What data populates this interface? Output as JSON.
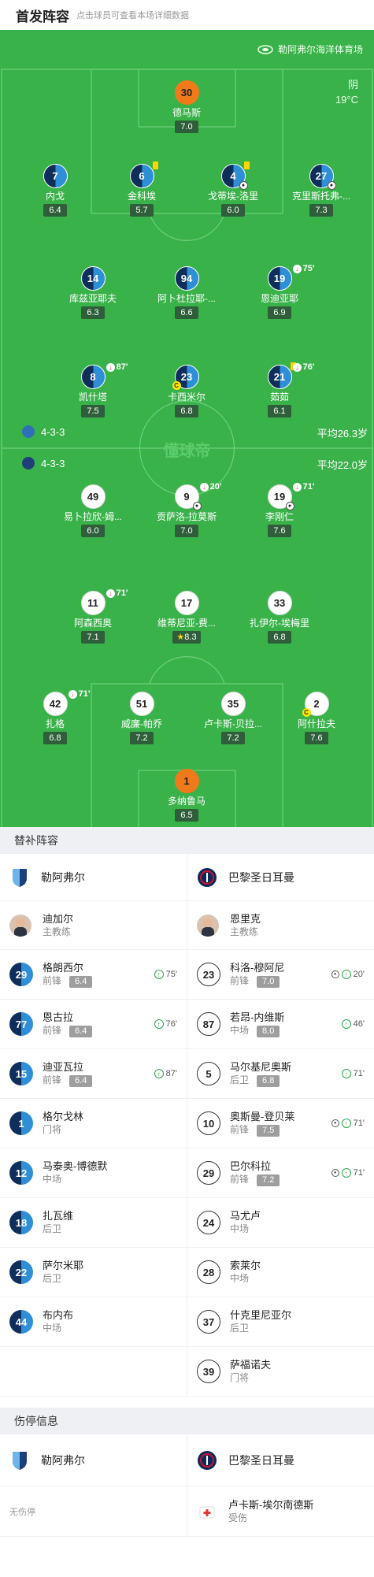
{
  "header": {
    "title": "首发阵容",
    "hint": "点击球员可查看本场详细数据"
  },
  "venue": "勒阿弗尔海洋体育场",
  "weather": {
    "condition": "阴",
    "temp": "19°C"
  },
  "home": {
    "formation": "4-3-3",
    "avg_age": "平均26.3岁",
    "players": [
      {
        "num": "30",
        "name": "德马斯",
        "rating": "7.0",
        "gk": true
      },
      {
        "num": "7",
        "name": "内戈",
        "rating": "6.4"
      },
      {
        "num": "6",
        "name": "金科埃",
        "rating": "5.7",
        "yellow": true
      },
      {
        "num": "4",
        "name": "戈蒂埃-洛里",
        "rating": "6.0",
        "yellow": true,
        "goal": true
      },
      {
        "num": "27",
        "name": "克里斯托弗-...",
        "rating": "7.3",
        "goal": true
      },
      {
        "num": "14",
        "name": "库兹亚耶夫",
        "rating": "6.3"
      },
      {
        "num": "94",
        "name": "阿卜杜拉耶-...",
        "rating": "6.6"
      },
      {
        "num": "19",
        "name": "恩迪亚耶",
        "rating": "6.9",
        "sub": "75'"
      },
      {
        "num": "8",
        "name": "凯什塔",
        "rating": "7.5",
        "sub": "87'"
      },
      {
        "num": "23",
        "name": "卡西米尔",
        "rating": "6.8",
        "captain": true
      },
      {
        "num": "21",
        "name": "茹茹",
        "rating": "6.1",
        "yellow": true,
        "sub": "76'"
      }
    ]
  },
  "watermark": "懂球帝",
  "away": {
    "formation": "4-3-3",
    "avg_age": "平均22.0岁",
    "players": [
      {
        "num": "49",
        "name": "易卜拉欣-姆...",
        "rating": "6.0"
      },
      {
        "num": "9",
        "name": "贡萨洛-拉莫斯",
        "rating": "7.0",
        "sub": "20'",
        "goal": true
      },
      {
        "num": "19",
        "name": "李刚仁",
        "rating": "7.6",
        "sub": "71'",
        "goal": true
      },
      {
        "num": "11",
        "name": "阿森西奥",
        "rating": "7.1",
        "sub": "71'"
      },
      {
        "num": "17",
        "name": "维蒂尼亚-费...",
        "rating": "8.3",
        "star": true
      },
      {
        "num": "33",
        "name": "扎伊尔-埃梅里",
        "rating": "6.8"
      },
      {
        "num": "42",
        "name": "扎格",
        "rating": "6.8",
        "sub": "71'"
      },
      {
        "num": "51",
        "name": "威廉-帕乔",
        "rating": "7.2"
      },
      {
        "num": "35",
        "name": "卢卡斯-贝拉...",
        "rating": "7.2"
      },
      {
        "num": "2",
        "name": "阿什拉夫",
        "rating": "7.6",
        "captain": true
      },
      {
        "num": "1",
        "name": "多纳鲁马",
        "rating": "6.5",
        "gk": true
      }
    ]
  },
  "subs": {
    "title": "替补阵容",
    "home_team": "勒阿弗尔",
    "away_team": "巴黎圣日耳曼",
    "home_coach": {
      "name": "迪加尔",
      "role": "主教练"
    },
    "away_coach": {
      "name": "恩里克",
      "role": "主教练"
    },
    "home": [
      {
        "num": "29",
        "name": "格朗西尔",
        "pos": "前锋",
        "rating": "6.4",
        "event": "75'"
      },
      {
        "num": "77",
        "name": "恩古拉",
        "pos": "前锋",
        "rating": "6.4",
        "event": "76'"
      },
      {
        "num": "15",
        "name": "迪亚瓦拉",
        "pos": "前锋",
        "rating": "6.4",
        "event": "87'"
      },
      {
        "num": "1",
        "name": "格尔戈林",
        "pos": "门将"
      },
      {
        "num": "12",
        "name": "马泰奥-博德默",
        "pos": "中场"
      },
      {
        "num": "18",
        "name": "扎瓦维",
        "pos": "后卫"
      },
      {
        "num": "22",
        "name": "萨尔米耶",
        "pos": "后卫"
      },
      {
        "num": "44",
        "name": "布内布",
        "pos": "中场"
      }
    ],
    "away": [
      {
        "num": "23",
        "name": "科洛-穆阿尼",
        "pos": "前锋",
        "rating": "7.0",
        "event": "20'",
        "goal": true
      },
      {
        "num": "87",
        "name": "若昂-内维斯",
        "pos": "中场",
        "rating": "8.0",
        "event": "46'"
      },
      {
        "num": "5",
        "name": "马尔基尼奥斯",
        "pos": "后卫",
        "rating": "6.8",
        "event": "71'"
      },
      {
        "num": "10",
        "name": "奥斯曼-登贝莱",
        "pos": "前锋",
        "rating": "7.5",
        "event": "71'",
        "goal": true
      },
      {
        "num": "29",
        "name": "巴尔科拉",
        "pos": "前锋",
        "rating": "7.2",
        "event": "71'",
        "goal": true
      },
      {
        "num": "24",
        "name": "马尤卢",
        "pos": "中场"
      },
      {
        "num": "28",
        "name": "索莱尔",
        "pos": "中场"
      },
      {
        "num": "37",
        "name": "什克里尼亚尔",
        "pos": "后卫"
      },
      {
        "num": "39",
        "name": "萨福诺夫",
        "pos": "门将"
      }
    ]
  },
  "injuries": {
    "title": "伤停信息",
    "home_team": "勒阿弗尔",
    "away_team": "巴黎圣日耳曼",
    "home_none": "无伤停",
    "away": [
      {
        "name": "卢卡斯-埃尔南德斯",
        "status": "受伤"
      }
    ]
  },
  "colors": {
    "pitch": "#3ab24a",
    "home_dark": "#0e2f5c",
    "home_light": "#2f8fd6",
    "gk": "#f07a1a",
    "sub_in": "#2aa845",
    "sub_out": "#e53935"
  }
}
